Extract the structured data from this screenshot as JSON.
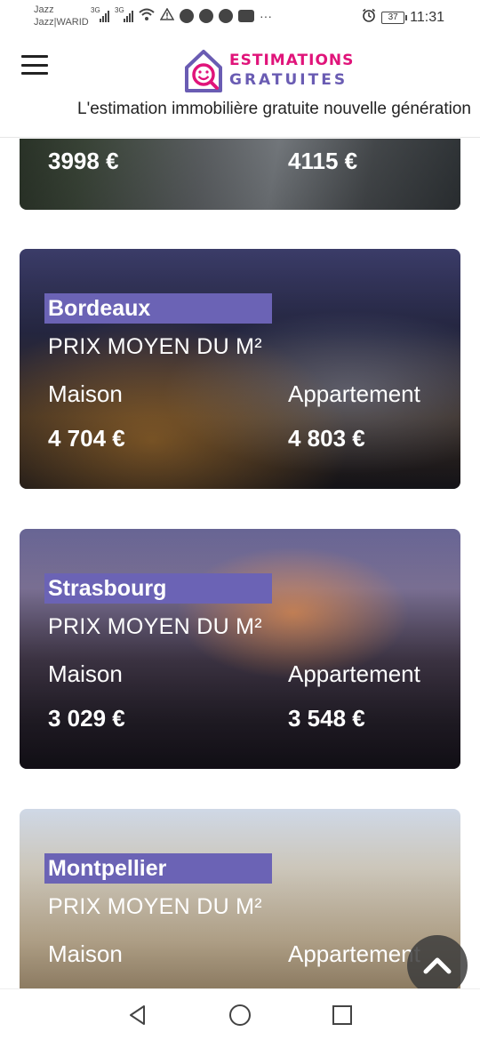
{
  "status_bar": {
    "carrier_line1": "Jazz",
    "carrier_line2": "Jazz|WARID",
    "network_tag_1": "3G",
    "network_tag_2": "3G",
    "battery": "37",
    "time": "11:31",
    "overflow": "···"
  },
  "header": {
    "logo_line1": "ESTIMATIONS",
    "logo_line2": "GRATUITES",
    "tagline": "L'estimation immobilière gratuite nouvelle génération"
  },
  "cards": [
    {
      "city": "",
      "prix_label": "",
      "maison_label": "",
      "appart_label": "",
      "maison_value": "3998 €",
      "appart_value": "4115 €"
    },
    {
      "city": "Bordeaux",
      "prix_label": "PRIX MOYEN DU M²",
      "maison_label": "Maison",
      "appart_label": "Appartement",
      "maison_value": "4 704 €",
      "appart_value": "4 803 €"
    },
    {
      "city": "Strasbourg",
      "prix_label": "PRIX MOYEN DU M²",
      "maison_label": "Maison",
      "appart_label": "Appartement",
      "maison_value": "3 029 €",
      "appart_value": "3 548 €"
    },
    {
      "city": "Montpellier",
      "prix_label": "PRIX MOYEN DU M²",
      "maison_label": "Maison",
      "appart_label": "Appartement",
      "maison_value": "",
      "appart_value": ""
    }
  ],
  "colors": {
    "brand_pink": "#e0147a",
    "brand_purple": "#6a5cb3",
    "city_label_bg": "#6b63b5"
  },
  "icons": {
    "menu": "hamburger-icon",
    "scroll_top": "chevron-up-icon",
    "back": "back-triangle-icon",
    "home": "home-circle-icon",
    "recents": "recents-square-icon"
  }
}
